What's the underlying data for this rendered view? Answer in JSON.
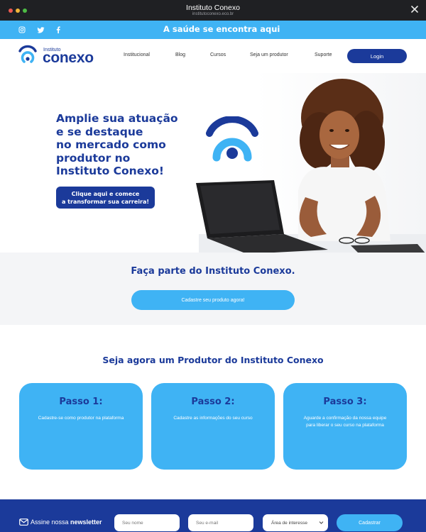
{
  "window": {
    "title": "Instituto Conexo",
    "url": "institutoconexo.eco.br"
  },
  "topbar": {
    "slogan": "A saúde se encontra aqui",
    "social_icons": [
      "instagram-icon",
      "twitter-icon",
      "facebook-icon"
    ]
  },
  "header": {
    "logo_small": "Instituto",
    "logo_big": "conexo",
    "nav": [
      "Institucional",
      "Blog",
      "Cursos",
      "Seja um produtor",
      "Suporte"
    ],
    "login_label": "Login"
  },
  "hero": {
    "title_lines": [
      "Amplie sua atuação",
      "e se destaque",
      "no mercado como",
      "produtor no",
      "Instituto Conexo!"
    ],
    "cta_lines": [
      "Clique aqui e comece",
      "a transformar sua carreira!"
    ]
  },
  "join": {
    "title": "Faça parte do Instituto Conexo.",
    "button_label": "Cadastre seu produto agora!"
  },
  "steps": {
    "title": "Seja agora um Produtor do Instituto Conexo",
    "items": [
      {
        "title": "Passo 1:",
        "text": "Cadastre-se como produtor na plataforma"
      },
      {
        "title": "Passo 2:",
        "text": "Cadastre as informações do seu curso"
      },
      {
        "title": "Passo 3:",
        "text": "Aguarde a confirmação da nossa equipe para liberar o seu curso na plataforma"
      }
    ]
  },
  "newsletter": {
    "label_prefix": "Assine nossa",
    "label_bold": "newsletter",
    "name_placeholder": "Seu nome",
    "email_placeholder": "Seu e-mail",
    "interest_selected": "Área de interesse",
    "submit_label": "Cadastrar"
  },
  "colors": {
    "brand_dark": "#1b3a9a",
    "brand_light": "#3fb3f4",
    "chrome": "#1f2023"
  }
}
